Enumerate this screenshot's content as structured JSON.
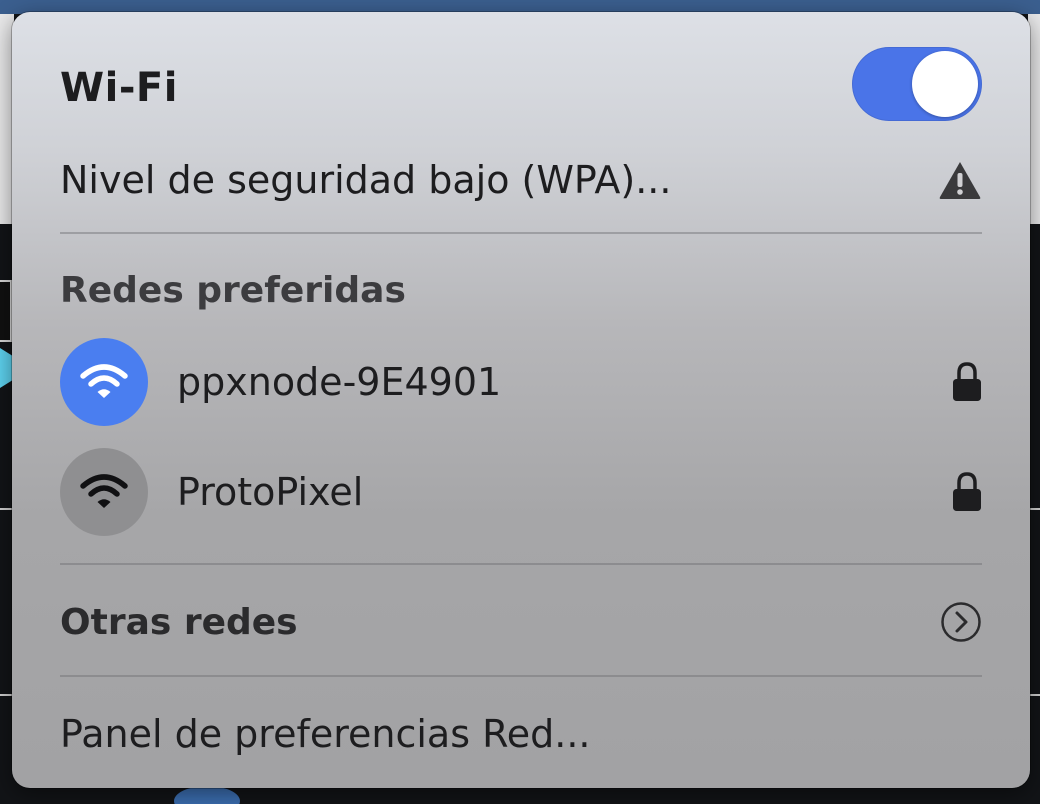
{
  "wifi": {
    "title": "Wi-Fi",
    "enabled": true,
    "toggle_color": "#4a74e8"
  },
  "security_warning": {
    "label": "Nivel de seguridad bajo (WPA)...",
    "icon": "warning-triangle-icon"
  },
  "preferred": {
    "heading": "Redes preferidas",
    "networks": [
      {
        "name": "ppxnode-9E4901",
        "connected": true,
        "secured": true,
        "icon": "wifi-icon",
        "lock_icon": "lock-icon"
      },
      {
        "name": "ProtoPixel",
        "connected": false,
        "secured": true,
        "icon": "wifi-icon",
        "lock_icon": "lock-icon"
      }
    ]
  },
  "other_networks": {
    "label": "Otras redes",
    "icon": "chevron-right-circle-icon"
  },
  "preferences": {
    "label": "Panel de preferencias Red..."
  },
  "colors": {
    "accent": "#4a7ef0",
    "inactive_icon_bg": "#8f8f91"
  }
}
